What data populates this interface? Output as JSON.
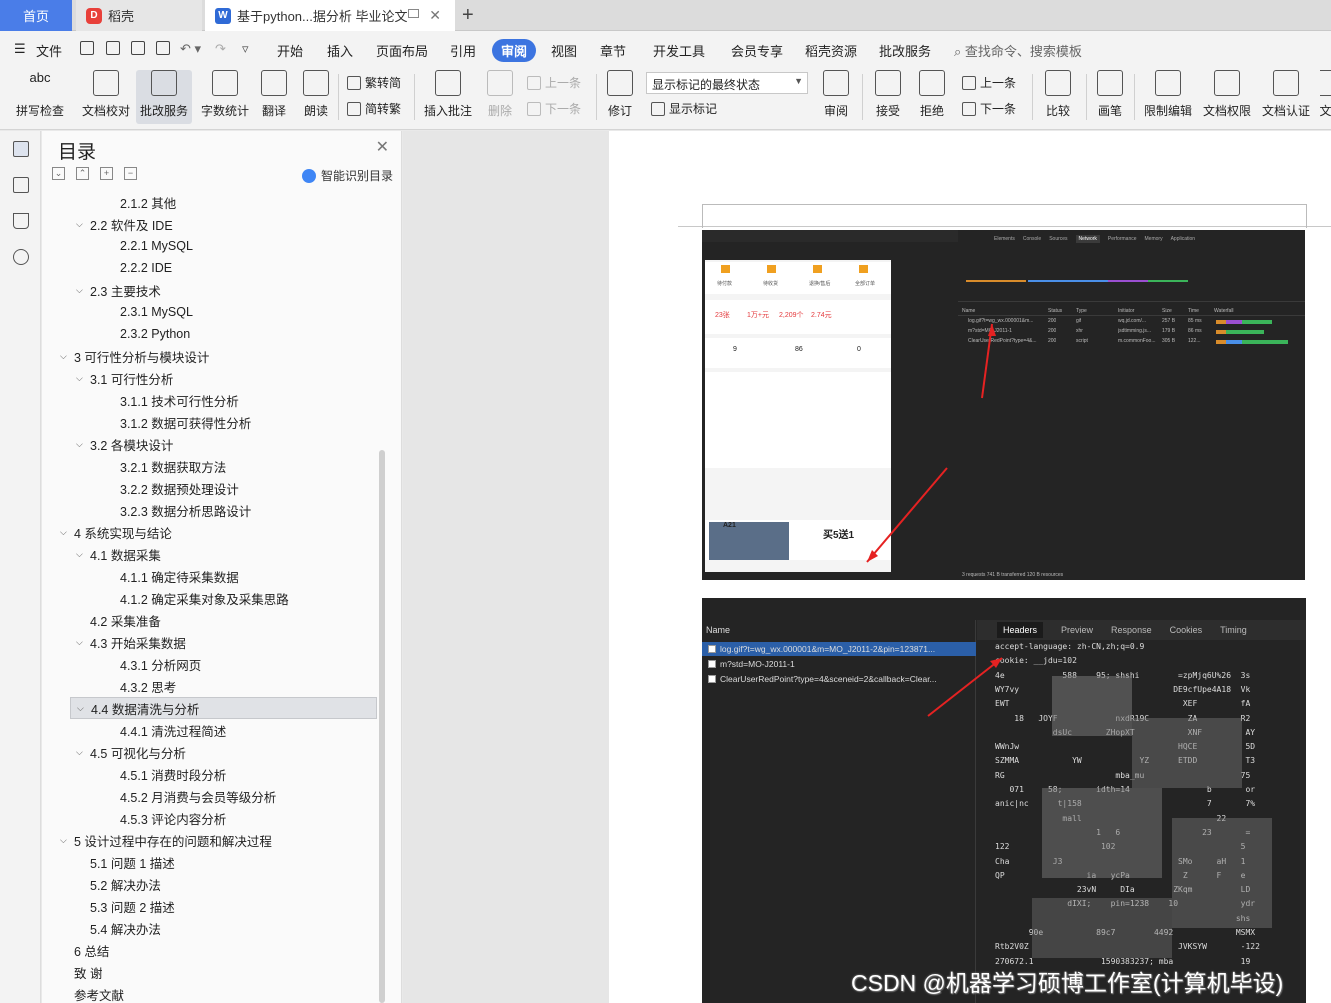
{
  "tabs": {
    "home": "首页",
    "daoke": "稻壳",
    "doc": "基于python...据分析 毕业论文",
    "add": "+"
  },
  "menu": {
    "file": "文件",
    "items": [
      "开始",
      "插入",
      "页面布局",
      "引用",
      "审阅",
      "视图",
      "章节",
      "开发工具",
      "会员专享",
      "稻壳资源",
      "批改服务"
    ],
    "active": "审阅",
    "search": "查找命令、搜索模板"
  },
  "ribbon": {
    "spell_icon_text": "abc",
    "spell": "拼写检查",
    "proofread": "文档校对",
    "correct": "批改服务",
    "wordcount": "字数统计",
    "translate": "翻译",
    "read": "朗读",
    "t2s": "繁转简",
    "s2t": "简转繁",
    "insert_comment": "插入批注",
    "delete": "删除",
    "prev": "上一条",
    "next": "下一条",
    "revise": "修订",
    "mark_state": "显示标记的最终状态",
    "show_marks": "显示标记",
    "review": "审阅",
    "accept": "接受",
    "reject": "拒绝",
    "prev2": "上一条",
    "next2": "下一条",
    "compare": "比较",
    "pen": "画笔",
    "restrict": "限制编辑",
    "rights": "文档权限",
    "certify": "文档认证",
    "cut": "文"
  },
  "toc": {
    "title": "目录",
    "ai": "智能识别目录",
    "items": [
      {
        "label": "2.1.2  其他",
        "level": 3
      },
      {
        "label": "2.2 软件及 IDE",
        "level": 2,
        "caret": true
      },
      {
        "label": "2.2.1 MySQL",
        "level": 3
      },
      {
        "label": "2.2.2 IDE",
        "level": 3
      },
      {
        "label": "2.3 主要技术",
        "level": 2,
        "caret": true
      },
      {
        "label": "2.3.1 MySQL",
        "level": 3
      },
      {
        "label": "2.3.2 Python",
        "level": 3
      },
      {
        "label": "3  可行性分析与模块设计",
        "level": 1,
        "caret": true
      },
      {
        "label": "3.1  可行性分析",
        "level": 2,
        "caret": true
      },
      {
        "label": "3.1.1  技术可行性分析",
        "level": 3
      },
      {
        "label": "3.1.2  数据可获得性分析",
        "level": 3
      },
      {
        "label": "3.2  各模块设计",
        "level": 2,
        "caret": true
      },
      {
        "label": "3.2.1  数据获取方法",
        "level": 3
      },
      {
        "label": "3.2.2  数据预处理设计",
        "level": 3
      },
      {
        "label": "3.2.3  数据分析思路设计",
        "level": 3
      },
      {
        "label": "4  系统实现与结论",
        "level": 1,
        "caret": true
      },
      {
        "label": "4.1 数据采集",
        "level": 2,
        "caret": true
      },
      {
        "label": "4.1.1 确定待采集数据",
        "level": 3
      },
      {
        "label": "4.1.2 确定采集对象及采集思路",
        "level": 3
      },
      {
        "label": "4.2 采集准备",
        "level": 2
      },
      {
        "label": "4.3 开始采集数据",
        "level": 2,
        "caret": true
      },
      {
        "label": "4.3.1 分析网页",
        "level": 3
      },
      {
        "label": "4.3.2 思考",
        "level": 3
      },
      {
        "label": "4.4 数据清洗与分析",
        "level": 2,
        "caret": true,
        "highlight": true
      },
      {
        "label": "4.4.1 清洗过程简述",
        "level": 3
      },
      {
        "label": "4.5  可视化与分析",
        "level": 2,
        "caret": true
      },
      {
        "label": "4.5.1 消费时段分析",
        "level": 3
      },
      {
        "label": "4.5.2 月消费与会员等级分析",
        "level": 3
      },
      {
        "label": "4.5.3 评论内容分析",
        "level": 3
      },
      {
        "label": "5  设计过程中存在的问题和解决过程",
        "level": 1,
        "caret": true
      },
      {
        "label": "5.1 问题 1 描述",
        "level": 2
      },
      {
        "label": "5.2 解决办法",
        "level": 2
      },
      {
        "label": "5.3 问题 2 描述",
        "level": 2
      },
      {
        "label": "5.4 解决办法",
        "level": 2
      },
      {
        "label": "6  总结",
        "level": 1
      },
      {
        "label": "致    谢",
        "level": 1
      },
      {
        "label": "参考文献",
        "level": 1
      }
    ]
  },
  "image1": {
    "devtools_tabs": [
      "Elements",
      "Console",
      "Sources",
      "Network",
      "Performance",
      "Memory",
      "Application"
    ],
    "columns": [
      "Name",
      "Status",
      "Type",
      "Initiator",
      "Size",
      "Time",
      "Waterfall"
    ],
    "rows": [
      [
        "log.gif?t=wg_wx.000001&m...",
        "200",
        "gif",
        "wq.jd.com/...",
        "257 B",
        "85 ms"
      ],
      [
        "m?std=MO-J2011-1",
        "200",
        "xhr",
        "jsdtimming.js...",
        "179 B",
        "86 ms"
      ],
      [
        "ClearUserRedPoint?type=4&...",
        "200",
        "script",
        "m.commonFoo...",
        "305 B",
        "122..."
      ]
    ],
    "footer": "3 requests    741 B transferred    120 B resources",
    "phone_tiles": [
      "待付款",
      "待收货",
      "退换/售后",
      "全部订单"
    ],
    "phone_stats": [
      "23张",
      "1万+元",
      "2,209个",
      "2.74元"
    ],
    "phone_counts": [
      "9",
      "86",
      "0"
    ],
    "phone_promo": "买5送1",
    "phone_label": "A21"
  },
  "image2": {
    "name_header": "Name",
    "rows": [
      "log.gif?t=wg_wx.000001&m=MO_J2011-2&pin=123871...",
      "m?std=MO-J2011-1",
      "ClearUserRedPoint?type=4&sceneid=2&callback=Clear..."
    ],
    "tabs": [
      "Headers",
      "Preview",
      "Response",
      "Cookies",
      "Timing"
    ],
    "code_lines": [
      "accept-language: zh-CN,zh;q=0.9",
      "cookie: __jdu=102",
      "4e            588    95; shshi        =zpMjq6U%26  3s",
      "WY7vy                                DE9cfUpe4A18  Vk",
      "EWT                                    XEF         fA",
      "    18   JOYF            nxdR19C        ZA         R2",
      "            dsUc       ZHopXT           XNF         AY",
      "WWnJw                                 HQCE          5D",
      "SZMMA           YW            YZ      ETDD          T3",
      "RG                       mba_mu                    75",
      "   071     58;       idth=14                b       or",
      "anic|nc      t|158                          7       7%",
      "              mall                            22",
      "                     1   6                 23       =",
      "122                   102                          5",
      "Cha         J3                        SMo     aH   1",
      "QP                 ia   ycPa           Z      F    e",
      "                 23vN     DIa        ZKqm          LD",
      "               dIXI;    pin=1238    10             ydr",
      "                                                  shs",
      "       90e           89c7        4492             MSMX",
      "Rtb2V0Z                               JVKSYW       -122",
      "270672.1              1590383237; mba              19"
    ]
  },
  "watermark": "CSDN @机器学习硕博工作室(计算机毕设)"
}
